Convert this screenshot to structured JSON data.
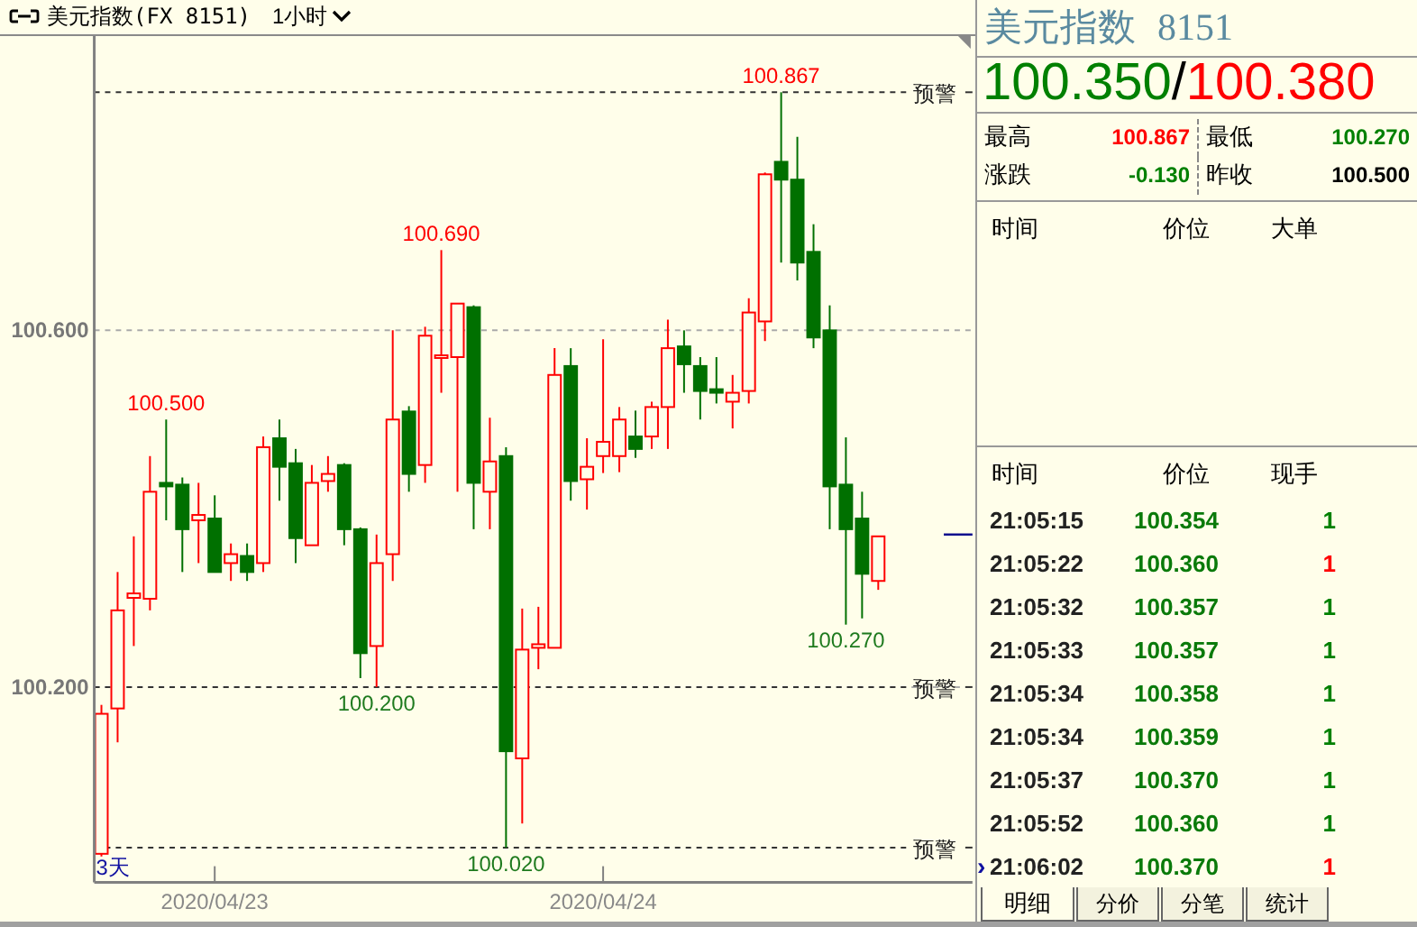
{
  "header": {
    "title": "美元指数(FX 8151)",
    "period": "1小时"
  },
  "chart": {
    "period_badge": "3天",
    "chart_data": {
      "type": "candlestick",
      "ylim": [
        99.981,
        100.93
      ],
      "yticks": [
        {
          "value": 100.2,
          "label": "100.200"
        },
        {
          "value": 100.6,
          "label": "100.600"
        }
      ],
      "categories": [
        null,
        null,
        null,
        null,
        null,
        null,
        null,
        "2020/04/23",
        null,
        null,
        null,
        null,
        null,
        null,
        null,
        null,
        null,
        null,
        null,
        null,
        null,
        null,
        null,
        null,
        null,
        null,
        null,
        null,
        null,
        null,
        null,
        "2020/04/24",
        null,
        null,
        null,
        null,
        null,
        null,
        null,
        null,
        null,
        null,
        null,
        null,
        null,
        null,
        null,
        null,
        null
      ],
      "ohlc": [
        [
          100.013,
          100.18,
          100.01,
          100.17
        ],
        [
          100.176,
          100.329,
          100.138,
          100.286
        ],
        [
          100.3,
          100.369,
          100.246,
          100.305
        ],
        [
          100.299,
          100.459,
          100.286,
          100.419
        ],
        [
          100.429,
          100.5,
          100.387,
          100.425
        ],
        [
          100.427,
          100.435,
          100.329,
          100.377
        ],
        [
          100.387,
          100.429,
          100.339,
          100.393
        ],
        [
          100.389,
          100.415,
          100.329,
          100.329
        ],
        [
          100.339,
          100.361,
          100.319,
          100.349
        ],
        [
          100.347,
          100.361,
          100.319,
          100.329
        ],
        [
          100.339,
          100.481,
          100.329,
          100.469
        ],
        [
          100.479,
          100.5,
          100.409,
          100.447
        ],
        [
          100.451,
          100.467,
          100.339,
          100.367
        ],
        [
          100.359,
          100.449,
          100.359,
          100.429
        ],
        [
          100.431,
          100.459,
          100.419,
          100.439
        ],
        [
          100.449,
          100.451,
          100.359,
          100.377
        ],
        [
          100.377,
          100.379,
          100.21,
          100.238
        ],
        [
          100.246,
          100.371,
          100.2,
          100.339
        ],
        [
          100.349,
          100.6,
          100.319,
          100.5
        ],
        [
          100.509,
          100.515,
          100.419,
          100.439
        ],
        [
          100.449,
          100.604,
          100.429,
          100.594
        ],
        [
          100.57,
          100.69,
          100.53,
          100.572
        ],
        [
          100.57,
          100.63,
          100.419,
          100.63
        ],
        [
          100.626,
          100.628,
          100.377,
          100.429
        ],
        [
          100.419,
          100.502,
          100.377,
          100.453
        ],
        [
          100.459,
          100.469,
          100.02,
          100.128
        ],
        [
          100.12,
          100.288,
          100.047,
          100.242
        ],
        [
          100.244,
          100.29,
          100.22,
          100.248
        ],
        [
          100.244,
          100.58,
          100.244,
          100.55
        ],
        [
          100.56,
          100.58,
          100.409,
          100.431
        ],
        [
          100.433,
          100.479,
          100.399,
          100.447
        ],
        [
          100.459,
          100.59,
          100.44,
          100.475
        ],
        [
          100.459,
          100.514,
          100.441,
          100.5
        ],
        [
          100.481,
          100.51,
          100.457,
          100.467
        ],
        [
          100.481,
          100.52,
          100.467,
          100.514
        ],
        [
          100.514,
          100.612,
          100.467,
          100.58
        ],
        [
          100.582,
          100.6,
          100.53,
          100.562
        ],
        [
          100.56,
          100.57,
          100.5,
          100.532
        ],
        [
          100.534,
          100.57,
          100.518,
          100.53
        ],
        [
          100.52,
          100.55,
          100.49,
          100.53
        ],
        [
          100.532,
          100.636,
          100.518,
          100.62
        ],
        [
          100.61,
          100.777,
          100.588,
          100.775
        ],
        [
          100.789,
          100.867,
          100.676,
          100.769
        ],
        [
          100.769,
          100.817,
          100.656,
          100.676
        ],
        [
          100.688,
          100.719,
          100.58,
          100.592
        ],
        [
          100.6,
          100.628,
          100.377,
          100.425
        ],
        [
          100.427,
          100.48,
          100.27,
          100.377
        ],
        [
          100.389,
          100.419,
          100.277,
          100.327
        ],
        [
          100.319,
          100.369,
          100.309,
          100.369
        ]
      ],
      "ref_lines": [
        {
          "label": "预警"
        },
        {
          "label": "预警"
        },
        {
          "label": "预警"
        }
      ],
      "annotations": [
        {
          "y": 100.867,
          "text": "100.867"
        },
        {
          "y": 100.2,
          "text": "100.200"
        },
        {
          "y": 100.02,
          "text": "100.020"
        },
        {
          "y": 100.69,
          "text": "100.690"
        },
        {
          "y": 100.5,
          "text": "100.500"
        },
        {
          "y": 100.27,
          "text": "100.270"
        }
      ]
    }
  },
  "quote": {
    "name": "美元指数",
    "code": "8151",
    "bid": "100.350",
    "separator": "/",
    "ask": "100.380",
    "stats": [
      {
        "label": "最高",
        "value": "100.867",
        "color": "#ff0000"
      },
      {
        "label": "最低",
        "value": "100.270",
        "color": "#008000"
      },
      {
        "label": "涨跌",
        "value": "-0.130",
        "color": "#008000"
      },
      {
        "label": "昨收",
        "value": "100.500",
        "color": "#000000"
      }
    ],
    "big_orders": {
      "columns": [
        "时间",
        "价位",
        "大单"
      ]
    },
    "ticks": {
      "columns": [
        "时间",
        "价位",
        "现手"
      ],
      "rows": [
        {
          "time": "21:05:15",
          "price": "100.354",
          "qty": "1",
          "color": "#008000"
        },
        {
          "time": "21:05:22",
          "price": "100.360",
          "qty": "1",
          "color": "#ff0000"
        },
        {
          "time": "21:05:32",
          "price": "100.357",
          "qty": "1",
          "color": "#008000"
        },
        {
          "time": "21:05:33",
          "price": "100.357",
          "qty": "1",
          "color": "#008000"
        },
        {
          "time": "21:05:34",
          "price": "100.358",
          "qty": "1",
          "color": "#008000"
        },
        {
          "time": "21:05:34",
          "price": "100.359",
          "qty": "1",
          "color": "#008000"
        },
        {
          "time": "21:05:37",
          "price": "100.370",
          "qty": "1",
          "color": "#008000"
        },
        {
          "time": "21:05:52",
          "price": "100.360",
          "qty": "1",
          "color": "#008000"
        },
        {
          "marker": "›",
          "time": "21:06:02",
          "price": "100.370",
          "qty": "1",
          "color": "#ff0000"
        }
      ]
    },
    "tabs": [
      {
        "label": "明细",
        "selected": true
      },
      {
        "label": "分价",
        "selected": false
      },
      {
        "label": "分笔",
        "selected": false
      },
      {
        "label": "统计",
        "selected": false
      }
    ]
  }
}
